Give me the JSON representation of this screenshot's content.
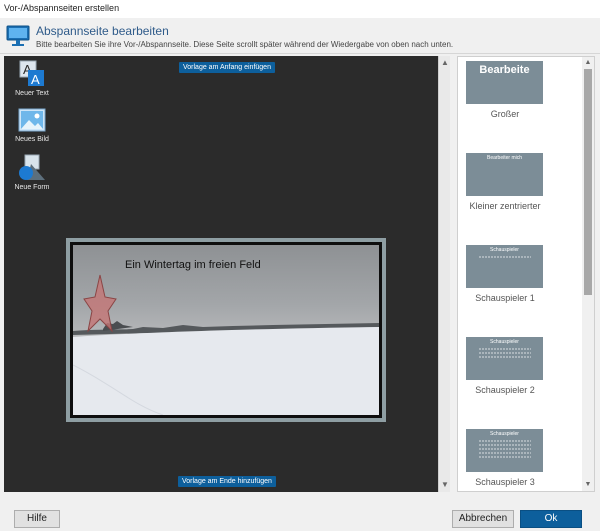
{
  "window": {
    "title": "Vor-/Abspannseiten erstellen"
  },
  "header": {
    "title": "Abspannseite bearbeiten",
    "subtitle": "Bitte bearbeiten Sie ihre Vor-/Abspannseite. Diese Seite scrollt später während der Wiedergabe von oben nach unten."
  },
  "tools": [
    {
      "label": "Neuer Text",
      "icon": "text-icon"
    },
    {
      "label": "Neues Bild",
      "icon": "image-icon"
    },
    {
      "label": "Neue Form",
      "icon": "shape-icon"
    }
  ],
  "editor": {
    "insert_top_label": "Vorlage am Anfang einfügen",
    "insert_bottom_label": "Vorlage am Ende hinzufügen",
    "caption": "Ein Wintertag im freien Feld"
  },
  "templates": [
    {
      "preview_text": "Bearbeite",
      "label": "Großer"
    },
    {
      "preview_text": "Bearbeiter mich",
      "label": "Kleiner zentrierter"
    },
    {
      "preview_text": "Schauspieler",
      "label": "Schauspieler 1"
    },
    {
      "preview_text": "Schauspieler",
      "label": "Schauspieler 2"
    },
    {
      "preview_text": "Schauspieler",
      "label": "Schauspieler 3"
    }
  ],
  "footer": {
    "help_label": "Hilfe",
    "cancel_label": "Abbrechen",
    "ok_label": "Ok"
  },
  "colors": {
    "accent": "#0d5f9c",
    "editor_bg": "#2b2b2b",
    "thumb_bg": "#7c8d97",
    "star": "#c47676"
  }
}
